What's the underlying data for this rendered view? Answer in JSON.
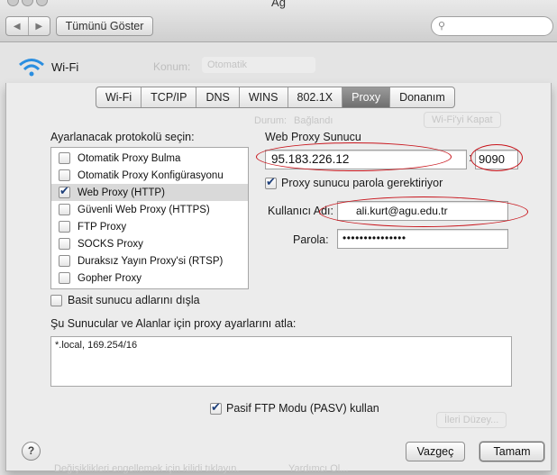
{
  "window": {
    "title": "Ağ",
    "show_all_label": "Tümünü Göster",
    "search_placeholder": ""
  },
  "background": {
    "service_name": "Wi-Fi",
    "location_label": "Konum:",
    "location_value": "Otomatik",
    "ghost_status_label": "Durum:",
    "ghost_status_value": "Bağlandı",
    "ghost_button": "Wi-Fi'yi Kapat",
    "ghost_bottom_button": "İleri Düzey...",
    "ghost_footer_text": "Değişiklikleri engellemek için kilidi tıklayın.",
    "ghost_footer_button": "Yardımcı Ol..."
  },
  "tabs": [
    {
      "label": "Wi-Fi",
      "active": false
    },
    {
      "label": "TCP/IP",
      "active": false
    },
    {
      "label": "DNS",
      "active": false
    },
    {
      "label": "WINS",
      "active": false
    },
    {
      "label": "802.1X",
      "active": false
    },
    {
      "label": "Proxy",
      "active": true
    },
    {
      "label": "Donanım",
      "active": false
    }
  ],
  "protocols": {
    "heading": "Ayarlanacak protokolü seçin:",
    "items": [
      {
        "label": "Otomatik Proxy Bulma",
        "checked": false,
        "selected": false
      },
      {
        "label": "Otomatik Proxy Konfigürasyonu",
        "checked": false,
        "selected": false
      },
      {
        "label": "Web Proxy (HTTP)",
        "checked": true,
        "selected": true
      },
      {
        "label": "Güvenli Web Proxy (HTTPS)",
        "checked": false,
        "selected": false
      },
      {
        "label": "FTP Proxy",
        "checked": false,
        "selected": false
      },
      {
        "label": "SOCKS Proxy",
        "checked": false,
        "selected": false
      },
      {
        "label": "Duraksız Yayın Proxy'si (RTSP)",
        "checked": false,
        "selected": false
      },
      {
        "label": "Gopher Proxy",
        "checked": false,
        "selected": false
      }
    ]
  },
  "proxy_server": {
    "heading": "Web Proxy Sunucu",
    "host": "95.183.226.12",
    "separator": ":",
    "port": "9090",
    "requires_password_label": "Proxy sunucu parola gerektiriyor",
    "requires_password": true,
    "username_label": "Kullanıcı Adı:",
    "username": "ali.kurt@agu.edu.tr",
    "password_label": "Parola:",
    "password_mask": "•••••••••••••••"
  },
  "exclude_simple_label": "Basit sunucu adlarını dışla",
  "exclude_simple": false,
  "bypass": {
    "heading": "Şu Sunucular ve Alanlar için proxy ayarlarını atla:",
    "value": "*.local, 169.254/16"
  },
  "passive_ftp_label": "Pasif FTP Modu (PASV) kullan",
  "passive_ftp": true,
  "buttons": {
    "help": "?",
    "cancel": "Vazgeç",
    "ok": "Tamam"
  },
  "colors": {
    "annotation_red": "#c8141b",
    "active_tab": "#7a7a7a",
    "check_blue": "#1d3f7a"
  }
}
